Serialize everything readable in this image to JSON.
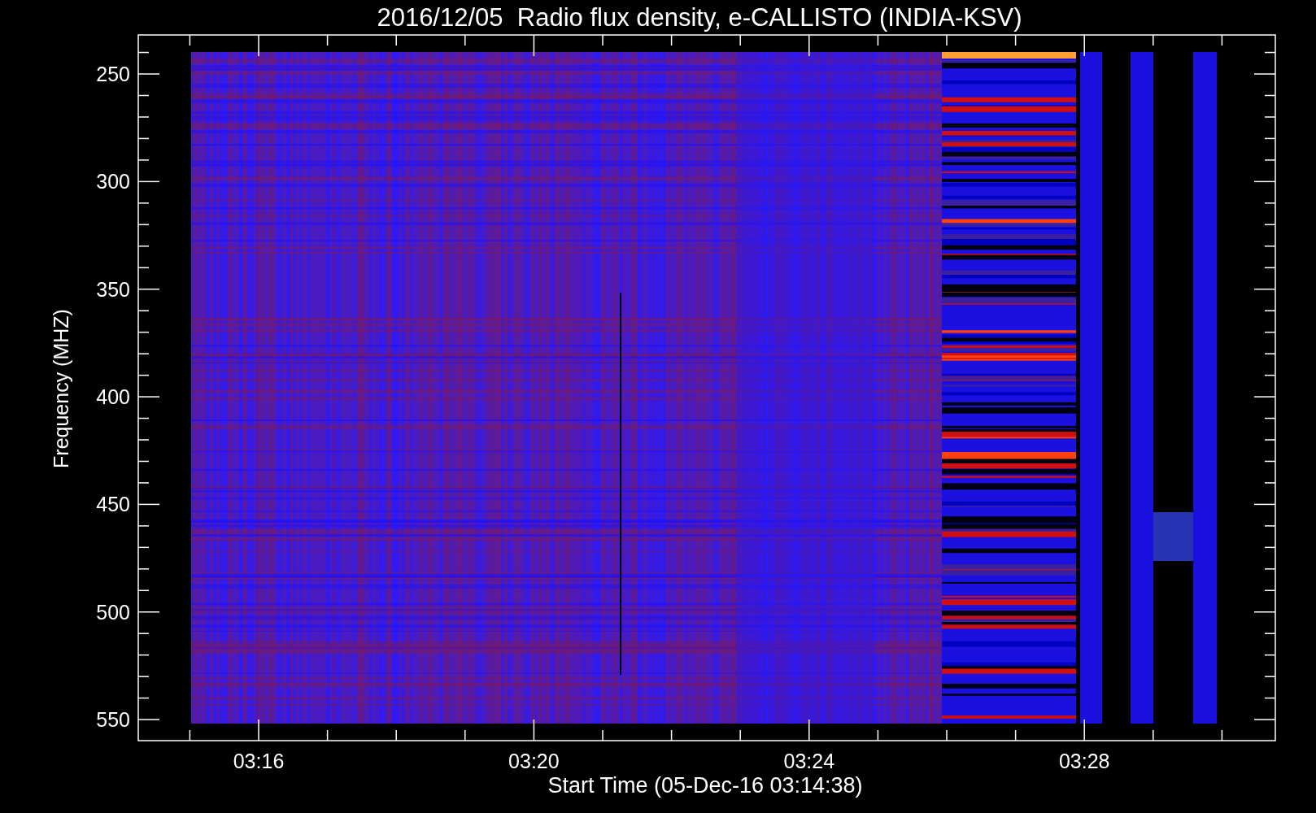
{
  "title": "2016/12/05  Radio flux density, e-CALLISTO (INDIA-KSV)",
  "plot": {
    "ylabel": "Frequency (MHZ)",
    "xlabel": "Start Time (05-Dec-16 03:14:38)",
    "y_tick_labels": [
      "250",
      "300",
      "350",
      "400",
      "450",
      "500",
      "550"
    ],
    "x_tick_labels": [
      "03:16",
      "03:20",
      "03:24",
      "03:28"
    ]
  }
}
